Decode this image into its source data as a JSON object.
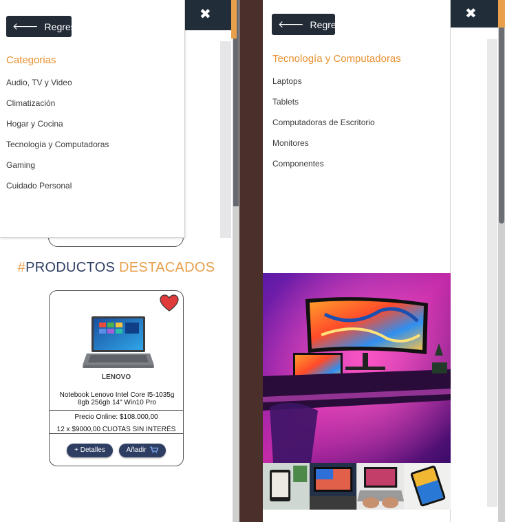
{
  "left_panel": {
    "back_label": "Regresar",
    "close_icon": "close-icon",
    "menu_title": "Categorias",
    "menu_items": [
      "Audio, TV y Video",
      "Climatización",
      "Hogar y Cocina",
      "Tecnología y Computadoras",
      "Gaming",
      "Cuidado Personal"
    ],
    "featured": {
      "hash": "#",
      "word1": "PRODUCTOS",
      "word2": "DESTACADOS"
    },
    "product": {
      "brand": "LENOVO",
      "name": "Notebook Lenovo Intel Core I5-1035g 8gb 256gb 14\" Win10 Pro",
      "price": "Precio Online:  $108.000,00",
      "installments": "12 x $9000,00  CUOTAS SIN INTERÉS",
      "details_label": "+ Detalles",
      "add_label": "Añadir",
      "favorite_icon": "heart-icon",
      "cart_icon": "cart-icon"
    }
  },
  "right_panel": {
    "back_label": "Regresar",
    "close_icon": "close-icon",
    "menu_title": "Tecnología y Computadoras",
    "menu_items": [
      "Laptops",
      "Tablets",
      "Computadoras de Escritorio",
      "Monitores",
      "Componentes"
    ]
  },
  "colors": {
    "dark_navy": "#222d3a",
    "accent_orange": "#e8a04c",
    "title_orange": "#e8902e",
    "product_blue": "#2e3e63",
    "favorite_red": "#e03b3b"
  }
}
